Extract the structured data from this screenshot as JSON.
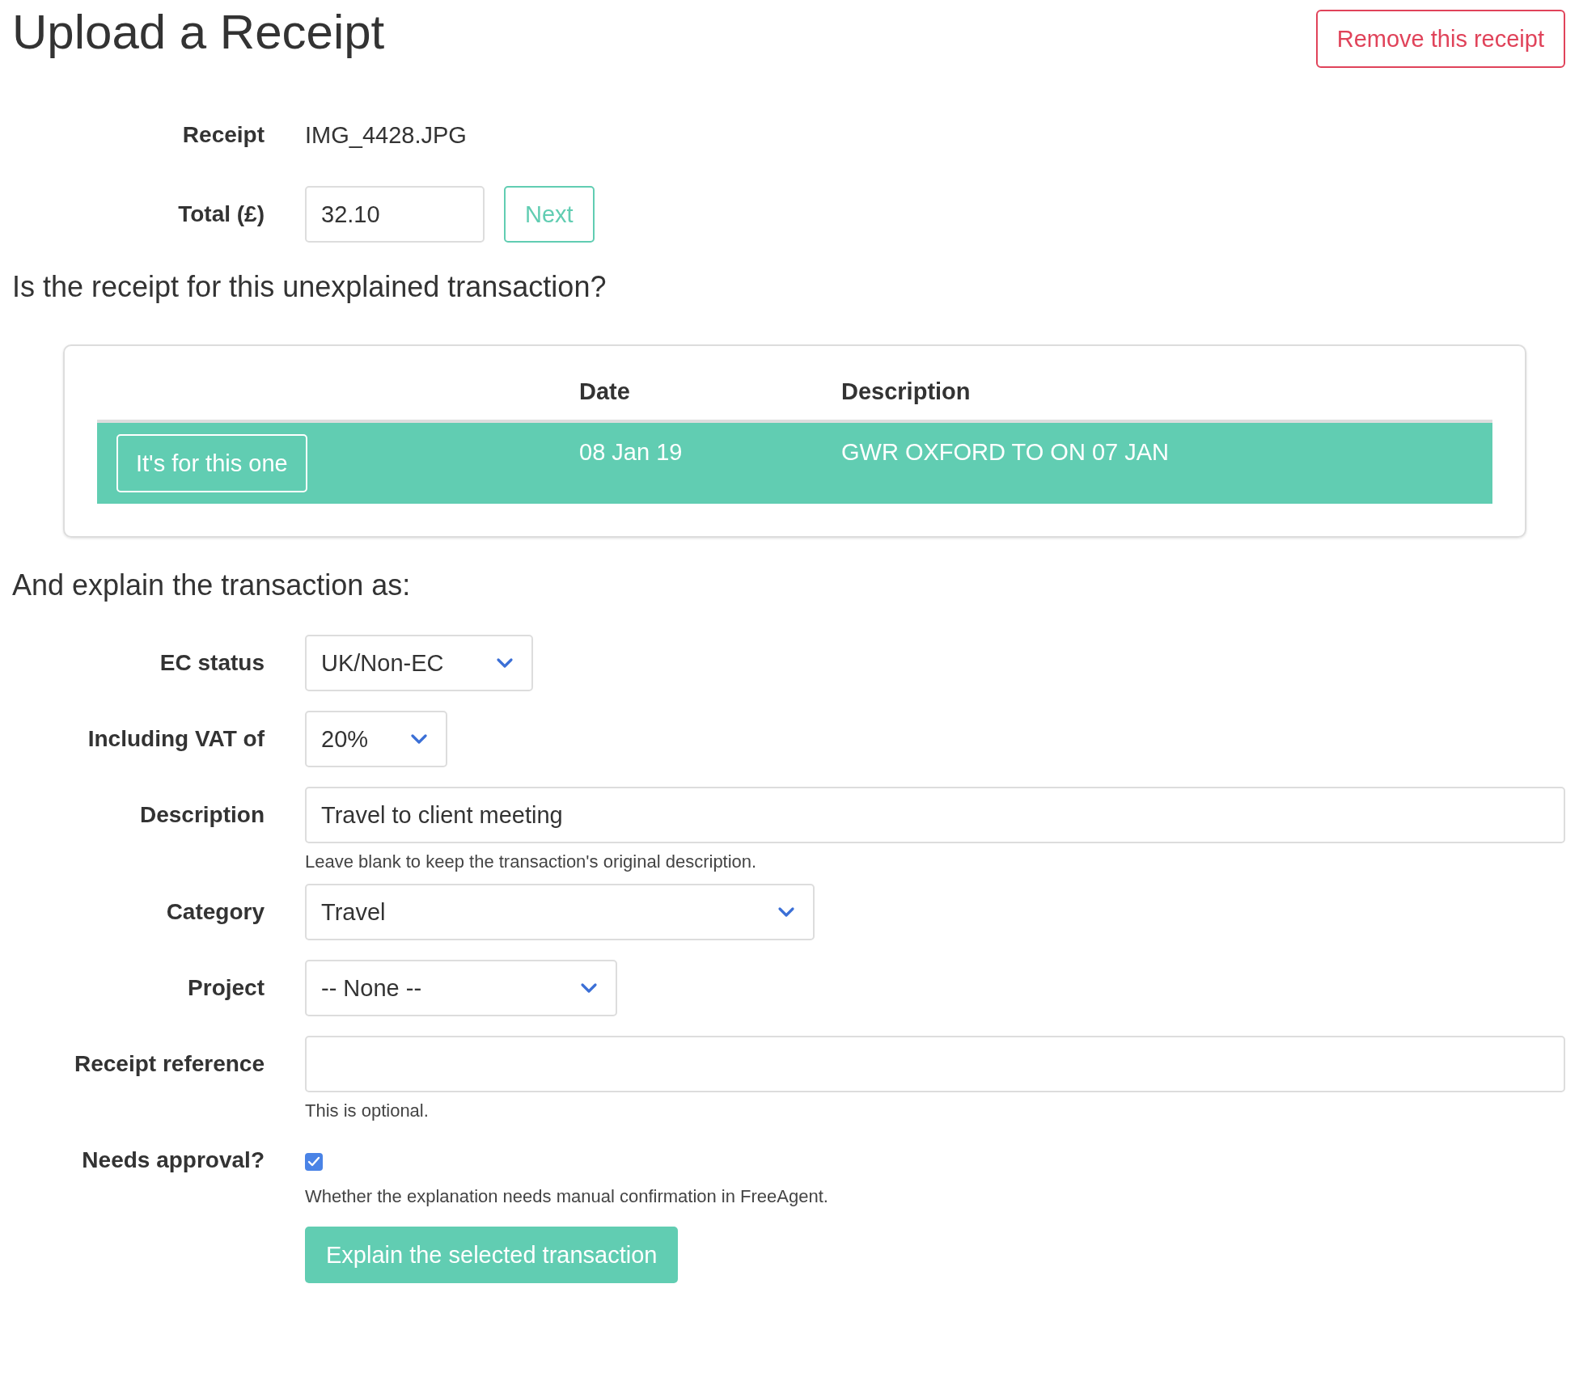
{
  "title": "Upload a Receipt",
  "remove_button": "Remove this receipt",
  "receipt": {
    "label": "Receipt",
    "value": "IMG_4428.JPG"
  },
  "total": {
    "label": "Total (£)",
    "value": "32.10",
    "button": "Next"
  },
  "question": "Is the receipt for this unexplained transaction?",
  "transactions": {
    "columns": [
      "Date",
      "Description"
    ],
    "rows": [
      {
        "button": "It's for this one",
        "date": "08 Jan 19",
        "description": "GWR OXFORD TO ON 07 JAN",
        "selected": true
      }
    ]
  },
  "explain_heading": "And explain the transaction as:",
  "fields": [
    {
      "kind": "select",
      "label": "EC status",
      "value": "UK/Non-EC"
    },
    {
      "kind": "select",
      "label": "Including VAT of",
      "value": "20%"
    },
    {
      "kind": "text",
      "label": "Description",
      "value": "Travel to client meeting",
      "help": "Leave blank to keep the transaction's original description."
    },
    {
      "kind": "select",
      "label": "Category",
      "value": "Travel"
    },
    {
      "kind": "select",
      "label": "Project",
      "value": "-- None --"
    },
    {
      "kind": "text",
      "label": "Receipt reference",
      "help": "This is optional."
    },
    {
      "kind": "checkbox",
      "label": "Needs approval?",
      "checked": true,
      "help": "Whether the explanation needs manual confirmation in FreeAgent."
    }
  ],
  "submit_button": "Explain the selected transaction"
}
